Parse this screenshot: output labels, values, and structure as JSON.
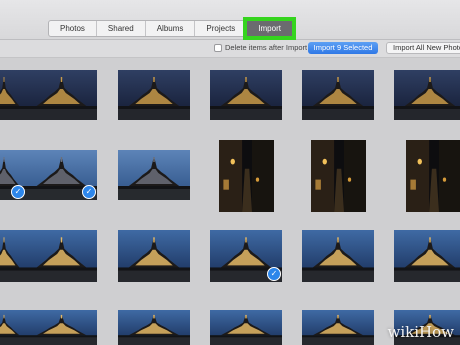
{
  "tabs": [
    {
      "label": "Photos"
    },
    {
      "label": "Shared"
    },
    {
      "label": "Albums"
    },
    {
      "label": "Projects"
    },
    {
      "label": "Import"
    }
  ],
  "toolbar": {
    "delete_after_import_label": "Delete items after Import",
    "delete_after_import_checked": false,
    "import_selected_label": "Import 9 Selected",
    "import_all_label": "Import All New Photos"
  },
  "colors": {
    "highlight": "#35d41e",
    "accent": "#2f78e6",
    "selection_check": "#2d86ea"
  },
  "thumbnails": [
    {
      "scene": "night",
      "selected": false
    },
    {
      "scene": "night",
      "selected": false
    },
    {
      "scene": "night",
      "selected": false
    },
    {
      "scene": "night",
      "selected": false
    },
    {
      "scene": "night",
      "selected": false
    },
    {
      "scene": "night",
      "selected": false
    },
    {
      "scene": "dusk",
      "selected": true
    },
    {
      "scene": "dusk",
      "selected": true
    },
    {
      "scene": "dusk",
      "selected": false
    },
    {
      "scene": "street",
      "selected": false
    },
    {
      "scene": "street",
      "selected": false
    },
    {
      "scene": "street",
      "selected": false
    },
    {
      "scene": "lit",
      "selected": false
    },
    {
      "scene": "lit",
      "selected": false
    },
    {
      "scene": "lit",
      "selected": false
    },
    {
      "scene": "lit",
      "selected": true
    },
    {
      "scene": "lit",
      "selected": false
    },
    {
      "scene": "lit",
      "selected": false
    },
    {
      "scene": "lit",
      "selected": false
    },
    {
      "scene": "lit",
      "selected": false
    },
    {
      "scene": "lit",
      "selected": false
    },
    {
      "scene": "lit",
      "selected": false
    },
    {
      "scene": "lit",
      "selected": false
    },
    {
      "scene": "lit",
      "selected": false
    }
  ],
  "watermark": "wikiHow"
}
